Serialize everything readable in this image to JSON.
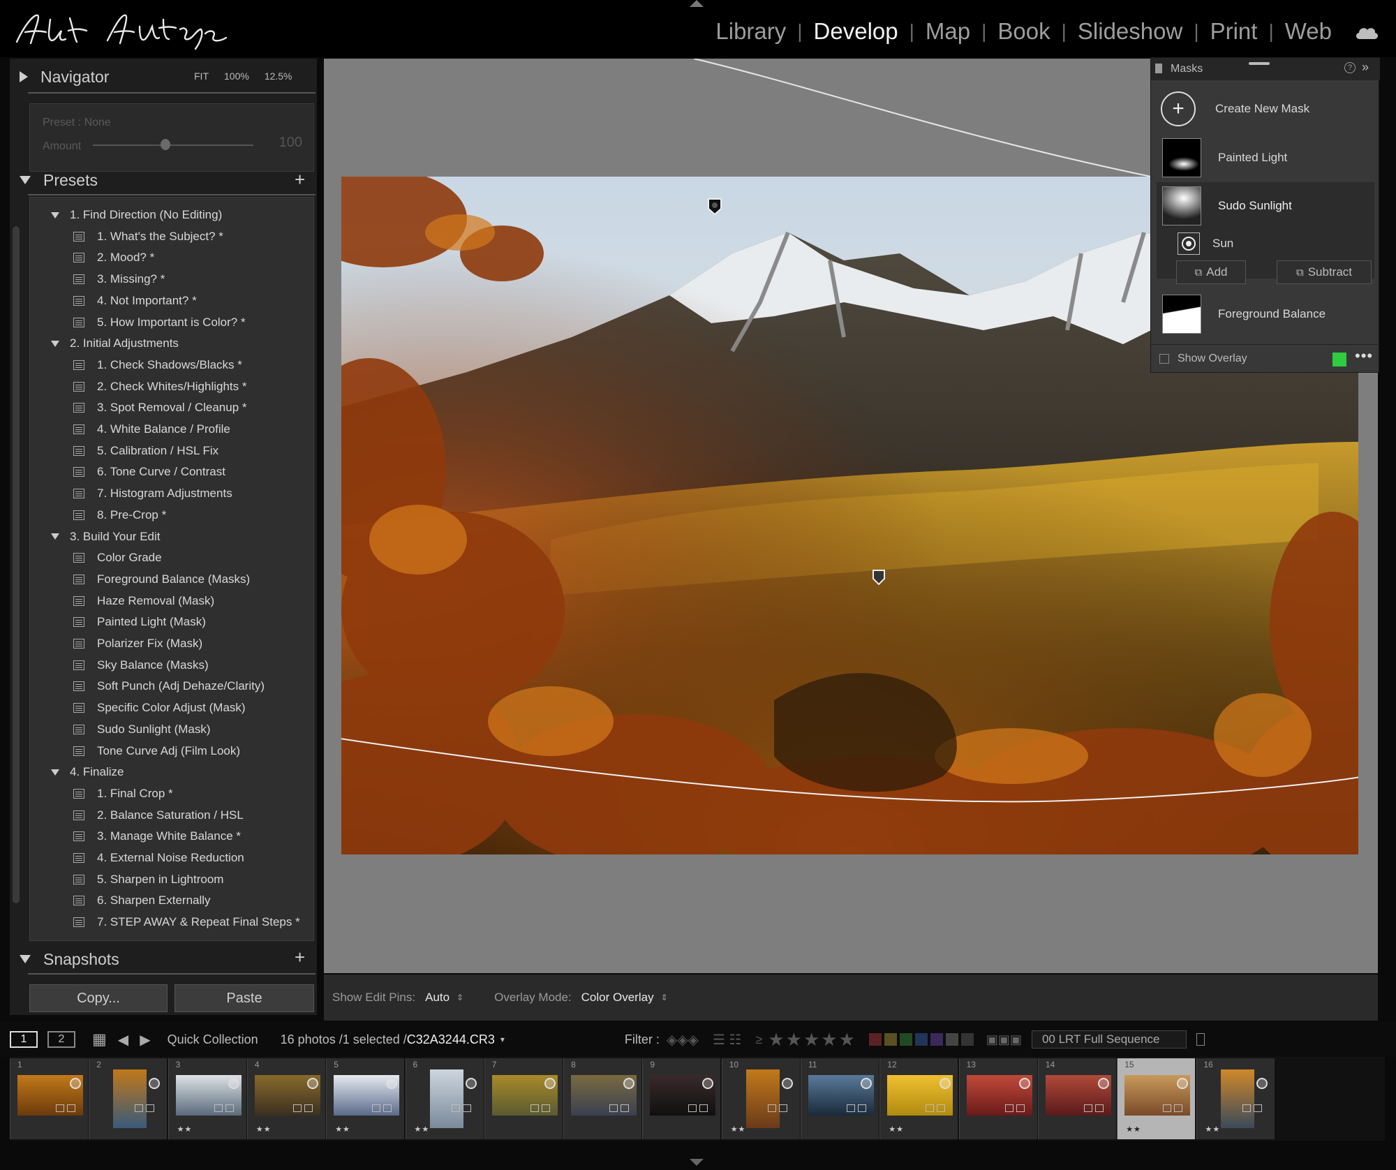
{
  "modules": [
    "Library",
    "Develop",
    "Map",
    "Book",
    "Slideshow",
    "Print",
    "Web"
  ],
  "active_module": "Develop",
  "navigator": {
    "title": "Navigator",
    "zoom": [
      "FIT",
      "100%",
      "12.5%"
    ]
  },
  "preset_amount": {
    "preset_label": "Preset : None",
    "amount_label": "Amount",
    "amount_value": "100",
    "amount_level": 0.45
  },
  "presets": {
    "title": "Presets",
    "items": [
      {
        "type": "folder",
        "label": "1. Find Direction (No Editing)"
      },
      {
        "type": "preset",
        "label": "1. What's the Subject? *"
      },
      {
        "type": "preset",
        "label": "2. Mood? *"
      },
      {
        "type": "preset",
        "label": "3. Missing? *"
      },
      {
        "type": "preset",
        "label": "4. Not Important? *"
      },
      {
        "type": "preset",
        "label": "5. How Important is Color? *"
      },
      {
        "type": "folder",
        "label": "2. Initial Adjustments"
      },
      {
        "type": "preset",
        "label": "1. Check Shadows/Blacks *"
      },
      {
        "type": "preset",
        "label": "2. Check Whites/Highlights *"
      },
      {
        "type": "preset",
        "label": "3. Spot Removal / Cleanup *"
      },
      {
        "type": "preset",
        "label": "4. White Balance / Profile"
      },
      {
        "type": "preset",
        "label": "5. Calibration / HSL Fix"
      },
      {
        "type": "preset",
        "label": "6. Tone Curve / Contrast"
      },
      {
        "type": "preset",
        "label": "7. Histogram Adjustments"
      },
      {
        "type": "preset",
        "label": "8. Pre-Crop *"
      },
      {
        "type": "folder",
        "label": "3. Build Your Edit"
      },
      {
        "type": "preset",
        "label": "Color Grade"
      },
      {
        "type": "preset",
        "label": "Foreground Balance (Masks)"
      },
      {
        "type": "preset",
        "label": "Haze Removal (Mask)"
      },
      {
        "type": "preset",
        "label": "Painted Light (Mask)"
      },
      {
        "type": "preset",
        "label": "Polarizer Fix (Mask)"
      },
      {
        "type": "preset",
        "label": "Sky Balance (Masks)"
      },
      {
        "type": "preset",
        "label": "Soft Punch (Adj Dehaze/Clarity)"
      },
      {
        "type": "preset",
        "label": "Specific Color Adjust (Mask)"
      },
      {
        "type": "preset",
        "label": "Sudo Sunlight (Mask)"
      },
      {
        "type": "preset",
        "label": "Tone Curve Adj (Film Look)"
      },
      {
        "type": "folder",
        "label": "4. Finalize"
      },
      {
        "type": "preset",
        "label": "1. Final Crop *"
      },
      {
        "type": "preset",
        "label": "2. Balance Saturation / HSL"
      },
      {
        "type": "preset",
        "label": "3. Manage White Balance *"
      },
      {
        "type": "preset",
        "label": "4. External Noise Reduction"
      },
      {
        "type": "preset",
        "label": "5. Sharpen in Lightroom"
      },
      {
        "type": "preset",
        "label": "6. Sharpen Externally"
      },
      {
        "type": "preset",
        "label": "7. STEP AWAY & Repeat Final Steps *"
      }
    ]
  },
  "snapshots": {
    "title": "Snapshots"
  },
  "buttons": {
    "copy": "Copy...",
    "paste": "Paste"
  },
  "toolbar": {
    "edit_pins_label": "Show Edit Pins:",
    "edit_pins_value": "Auto",
    "overlay_label": "Overlay Mode:",
    "overlay_value": "Color Overlay"
  },
  "masks": {
    "title": "Masks",
    "create": "Create New Mask",
    "items": [
      "Painted Light",
      "Sudo Sunlight",
      "Foreground Balance"
    ],
    "sub_item": "Sun",
    "add": "Add",
    "subtract": "Subtract",
    "show_overlay": "Show Overlay",
    "overlay_color": "#2ecc40"
  },
  "filmstrip_bar": {
    "page1": "1",
    "page2": "2",
    "source": "Quick Collection",
    "count": "16 photos /1 selected /",
    "filename": "C32A3244.CR3",
    "filter_label": "Filter :",
    "collection": "00 LRT Full Sequence"
  },
  "filmstrip": [
    {
      "n": "1",
      "stars": ""
    },
    {
      "n": "2",
      "stars": ""
    },
    {
      "n": "3",
      "stars": "★★"
    },
    {
      "n": "4",
      "stars": "★★"
    },
    {
      "n": "5",
      "stars": "★★"
    },
    {
      "n": "6",
      "stars": "★★"
    },
    {
      "n": "7",
      "stars": ""
    },
    {
      "n": "8",
      "stars": ""
    },
    {
      "n": "9",
      "stars": ""
    },
    {
      "n": "10",
      "stars": "★★"
    },
    {
      "n": "11",
      "stars": ""
    },
    {
      "n": "12",
      "stars": "★★"
    },
    {
      "n": "13",
      "stars": ""
    },
    {
      "n": "14",
      "stars": ""
    },
    {
      "n": "15",
      "stars": "★★"
    },
    {
      "n": "16",
      "stars": "★★"
    }
  ],
  "colors": {
    "accent_overlay": "#2ecc40",
    "panel_bg": "#1e1e1e",
    "canvas_bg": "#7e7e7e"
  }
}
